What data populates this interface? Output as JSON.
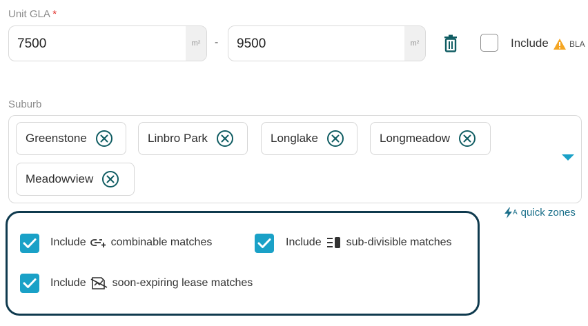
{
  "gla": {
    "label": "Unit GLA",
    "required_mark": "*",
    "min_value": "7500",
    "max_value": "9500",
    "unit": "m²",
    "separator": "-",
    "include_label": "Include",
    "include_badge": "BLA"
  },
  "suburb": {
    "label": "Suburb",
    "chips": [
      "Greenstone",
      "Linbro Park",
      "Longlake",
      "Longmeadow",
      "Meadowview"
    ]
  },
  "quick_zones": {
    "label": "quick zones",
    "icon_superscript": "A"
  },
  "matches": {
    "combinable": {
      "prefix": "Include",
      "text": "combinable matches",
      "checked": true
    },
    "subdivisible": {
      "prefix": "Include",
      "text": "sub-divisible matches",
      "checked": true
    },
    "expiring": {
      "prefix": "Include",
      "text": "soon-expiring lease matches",
      "checked": true
    }
  },
  "colors": {
    "accent": "#1aa1c7",
    "chip_icon": "#0f5c62",
    "border_dark": "#0f3a4e",
    "warning": "#f5a623",
    "required": "#e0322d"
  }
}
